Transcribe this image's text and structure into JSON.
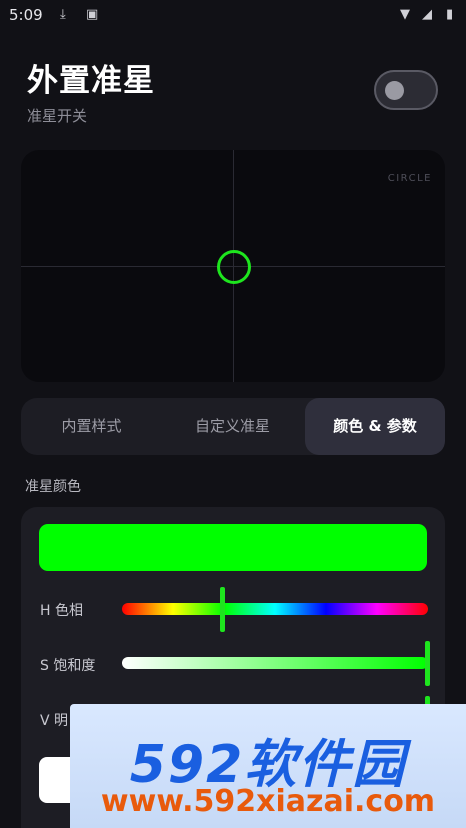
{
  "status_bar": {
    "time": "5:09",
    "icons": [
      "download-icon",
      "notification-icon",
      "wifi-icon",
      "signal-icon",
      "battery-icon"
    ]
  },
  "header": {
    "title": "外置准星",
    "subtitle": "准星开关",
    "toggle_on": false
  },
  "preview": {
    "mode_label": "CIRCLE",
    "reticle_color": "#1ee51e",
    "background": "#0a0a0e"
  },
  "tabs": [
    {
      "label": "内置样式",
      "active": false
    },
    {
      "label": "自定义准星",
      "active": false
    },
    {
      "label": "颜色 & 参数",
      "active": true
    }
  ],
  "color_section": {
    "label": "准星颜色",
    "swatch_color": "#00ff00",
    "sliders": [
      {
        "label": "H 色相",
        "value_fraction": 0.33
      },
      {
        "label": "S 饱和度",
        "value_fraction": 1.0
      },
      {
        "label": "V 明",
        "value_fraction": 1.0
      }
    ]
  },
  "watermark": {
    "brand": "592软件园",
    "url": "www.592xiazai.com"
  },
  "colors": {
    "accent": "#1ee51e",
    "background": "#111116",
    "card": "#1d1d24"
  }
}
